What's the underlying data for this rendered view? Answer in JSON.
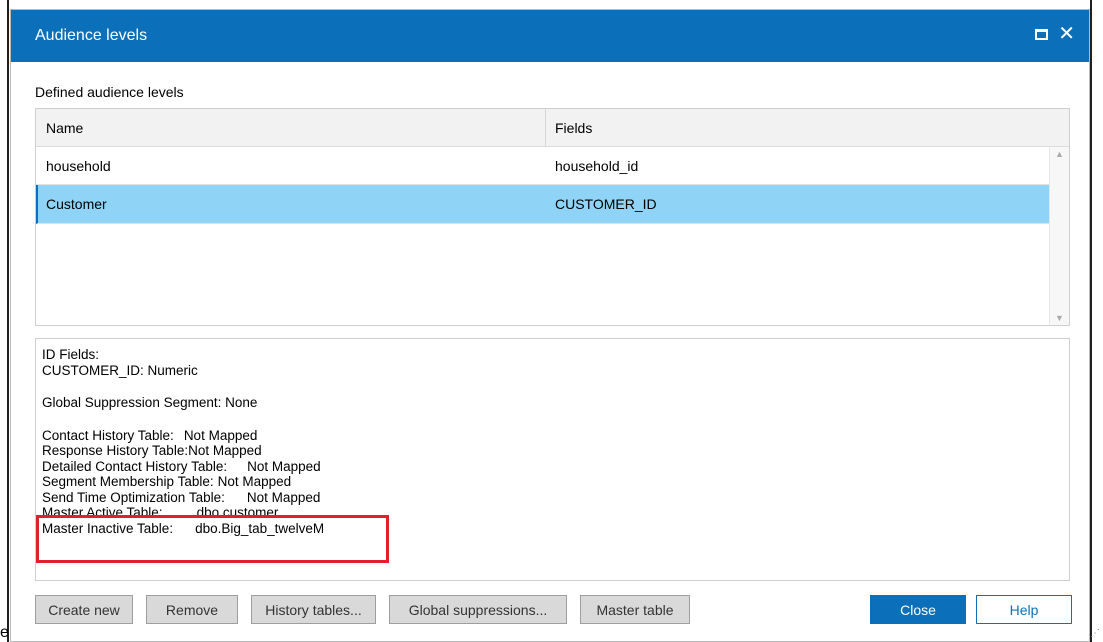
{
  "background": {
    "stray_text": "e"
  },
  "dialog": {
    "title": "Audience levels",
    "section_label": "Defined audience levels",
    "columns": [
      "Name",
      "Fields"
    ],
    "rows": [
      {
        "name": "household",
        "fields": "household_id",
        "selected": false
      },
      {
        "name": "Customer",
        "fields": "CUSTOMER_ID",
        "selected": true
      }
    ],
    "details": {
      "id_fields_heading": "ID Fields:",
      "id_field_value": "CUSTOMER_ID: Numeric",
      "global_suppression": "Global Suppression Segment: None",
      "mappings": [
        {
          "label": "Contact History Table:",
          "value": "Not Mapped"
        },
        {
          "label": "Response History Table:",
          "value": "Not Mapped"
        },
        {
          "label": "Detailed Contact History Table:",
          "value": "Not Mapped"
        },
        {
          "label": "Segment Membership Table:",
          "value": "Not Mapped"
        },
        {
          "label": "Send Time Optimization Table:",
          "value": "Not Mapped"
        },
        {
          "label": "Master Active Table:",
          "value": "dbo.customer"
        },
        {
          "label": "Master Inactive Table:",
          "value": "dbo.Big_tab_twelveM"
        }
      ]
    },
    "buttons": {
      "create_new": "Create new",
      "remove": "Remove",
      "history_tables": "History tables...",
      "global_suppressions": "Global suppressions...",
      "master_table": "Master table",
      "close": "Close",
      "help": "Help"
    },
    "colors": {
      "titlebar": "#0b70b9",
      "selected_row": "#8fd3f7",
      "highlight": "#e0202a"
    }
  }
}
